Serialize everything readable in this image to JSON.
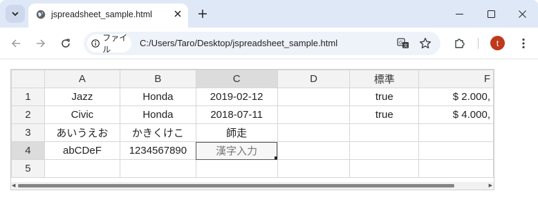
{
  "browser": {
    "tab": {
      "title": "jspreadsheet_sample.html"
    },
    "address": {
      "chip_label": "ファイル",
      "url": "C:/Users/Taro/Desktop/jspreadsheet_sample.html"
    },
    "profile_initial": "t",
    "icons": [
      "tab-search-icon",
      "globe-icon",
      "close-icon",
      "plus-icon",
      "minimize-icon",
      "maximize-icon",
      "window-close-icon",
      "back-arrow-icon",
      "forward-arrow-icon",
      "reload-icon",
      "info-icon",
      "translate-icon",
      "star-icon",
      "extensions-icon",
      "more-vert-icon"
    ]
  },
  "spreadsheet": {
    "columns": [
      "A",
      "B",
      "C",
      "D",
      "標準",
      "F"
    ],
    "selected_column": "C",
    "selected_row": "4",
    "rows": [
      {
        "num": "1",
        "cells": [
          "Jazz",
          "Honda",
          "2019-02-12",
          "",
          "true",
          "$ 2.000,"
        ]
      },
      {
        "num": "2",
        "cells": [
          "Civic",
          "Honda",
          "2018-07-11",
          "",
          "true",
          "$ 4.000,"
        ]
      },
      {
        "num": "3",
        "cells": [
          "あいうえお",
          "かきくけこ",
          "師走",
          "",
          "",
          ""
        ]
      },
      {
        "num": "4",
        "cells": [
          "abCDeF",
          "1234567890",
          "漢字入力",
          "",
          "",
          ""
        ]
      },
      {
        "num": "5",
        "cells": [
          "",
          "",
          "",
          "",
          "",
          ""
        ]
      }
    ]
  }
}
